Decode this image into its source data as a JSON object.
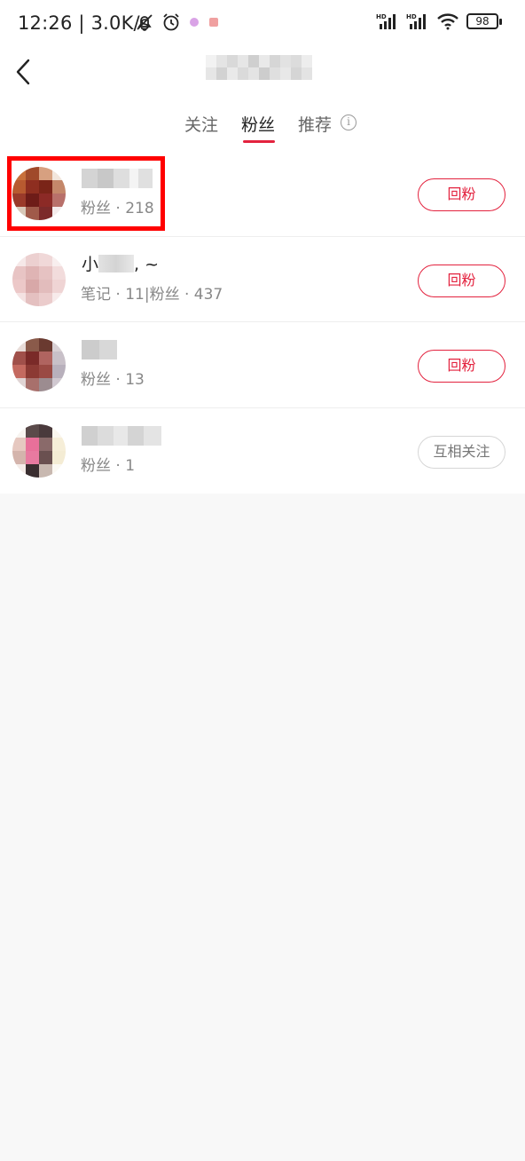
{
  "status_bar": {
    "time": "12:26",
    "speed": "3.0K/s",
    "battery": "98",
    "icons": [
      "bell-off-icon",
      "alarm-icon",
      "app-notification-icon",
      "signal-hd-icon",
      "signal-hd-icon",
      "wifi-icon",
      "battery-icon"
    ]
  },
  "header": {
    "back_icon": "chevron-left-icon"
  },
  "tabs": [
    {
      "label": "关注"
    },
    {
      "label": "粉丝"
    },
    {
      "label": "推荐"
    }
  ],
  "active_tab": "粉丝",
  "colors": {
    "accent": "#e3223e",
    "highlight": "#ff0000"
  },
  "fans": [
    {
      "meta": "粉丝 · 218",
      "button": "回粉"
    },
    {
      "name_prefix": "小",
      "name_suffix": ", ~",
      "meta": "笔记 · 11|粉丝 · 437",
      "button": "回粉"
    },
    {
      "meta": "粉丝 · 13",
      "button": "回粉"
    },
    {
      "meta": "粉丝 · 1",
      "button": "互相关注"
    }
  ]
}
